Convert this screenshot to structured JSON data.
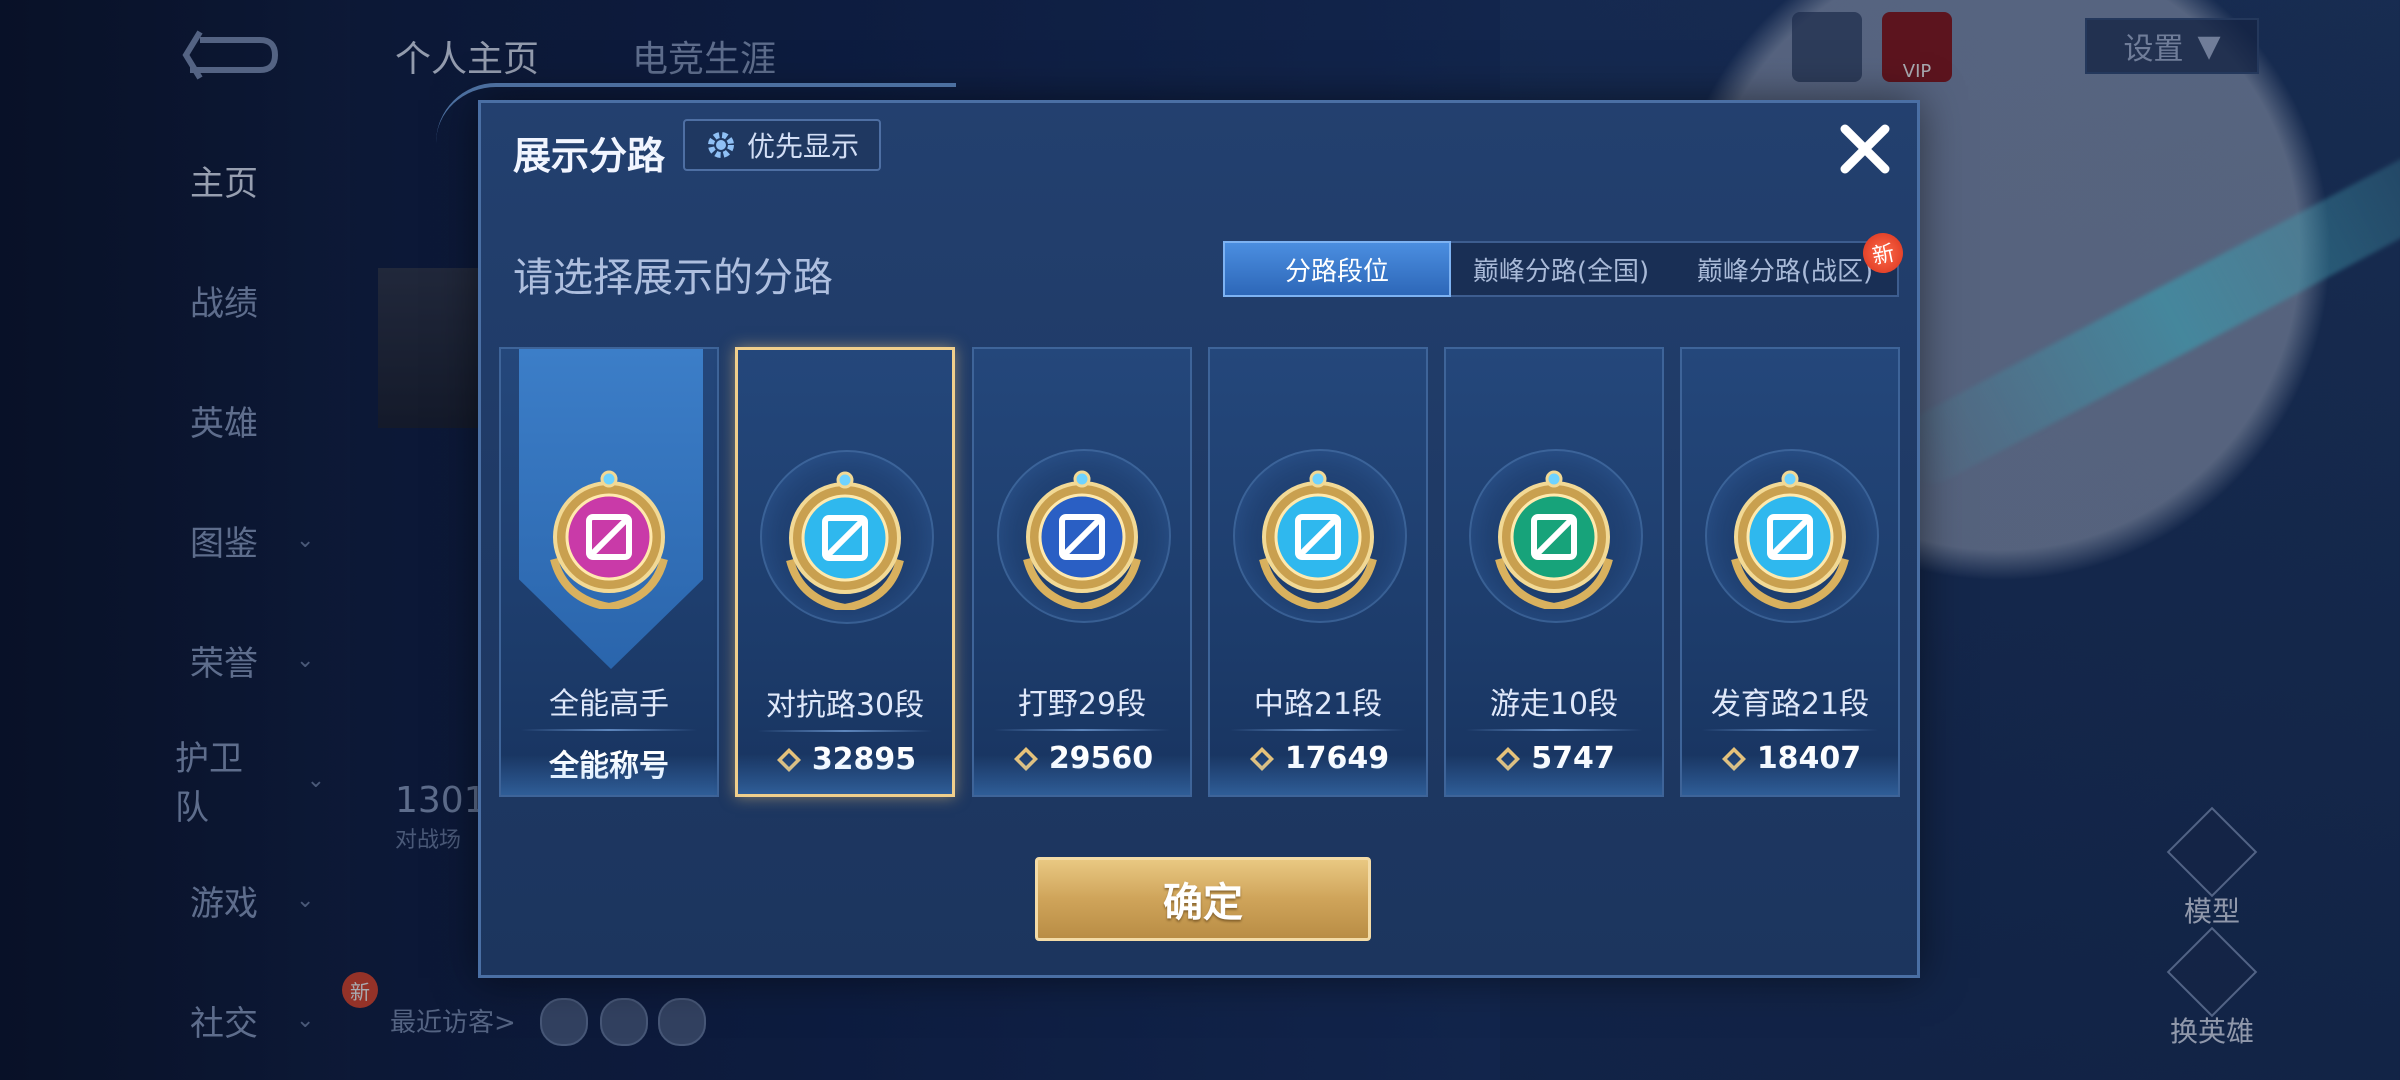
{
  "background": {
    "top_tabs": [
      "个人主页",
      "电竞生涯"
    ],
    "sidebar": [
      {
        "label": "主页",
        "chevron": false,
        "active": true
      },
      {
        "label": "战绩",
        "chevron": false
      },
      {
        "label": "英雄",
        "chevron": false
      },
      {
        "label": "图鉴",
        "chevron": true
      },
      {
        "label": "荣誉",
        "chevron": true
      },
      {
        "label": "护卫队",
        "chevron": true
      },
      {
        "label": "游戏",
        "chevron": true
      },
      {
        "label": "社交",
        "chevron": true,
        "badge": "新"
      }
    ],
    "recent_visitors_label": "最近访客>",
    "settings_label": "设置",
    "vip_label": "VIP",
    "model_label": "模型",
    "switch_hero_label": "换英雄",
    "stat_value": "1301",
    "stat_sub": "对战场"
  },
  "modal": {
    "title": "展示分路",
    "priority_button": "优先显示",
    "subtitle": "请选择展示的分路",
    "tabs": [
      {
        "label": "分路段位",
        "active": true
      },
      {
        "label": "巅峰分路(全国)",
        "active": false
      },
      {
        "label": "巅峰分路(战区)",
        "active": false,
        "badge": "新"
      }
    ],
    "cards": [
      {
        "name": "全能高手",
        "value": "全能称号",
        "icon": "allround-badge-icon",
        "selected": false,
        "color": "#c93aa8"
      },
      {
        "name": "对抗路30段",
        "value": "32895",
        "icon": "clash-lane-badge-icon",
        "selected": true,
        "color": "#2fb8ee"
      },
      {
        "name": "打野29段",
        "value": "29560",
        "icon": "jungle-badge-icon",
        "selected": false,
        "color": "#2a5fc4"
      },
      {
        "name": "中路21段",
        "value": "17649",
        "icon": "mid-lane-badge-icon",
        "selected": false,
        "color": "#2fb8ee"
      },
      {
        "name": "游走10段",
        "value": "5747",
        "icon": "roam-badge-icon",
        "selected": false,
        "color": "#17a37a"
      },
      {
        "name": "发育路21段",
        "value": "18407",
        "icon": "farm-lane-badge-icon",
        "selected": false,
        "color": "#2fb8ee"
      }
    ],
    "confirm_label": "确定"
  },
  "colors": {
    "accent_gold": "#e0bb72",
    "tab_active": "#3f7fd2",
    "modal_bg": "#203c69"
  }
}
